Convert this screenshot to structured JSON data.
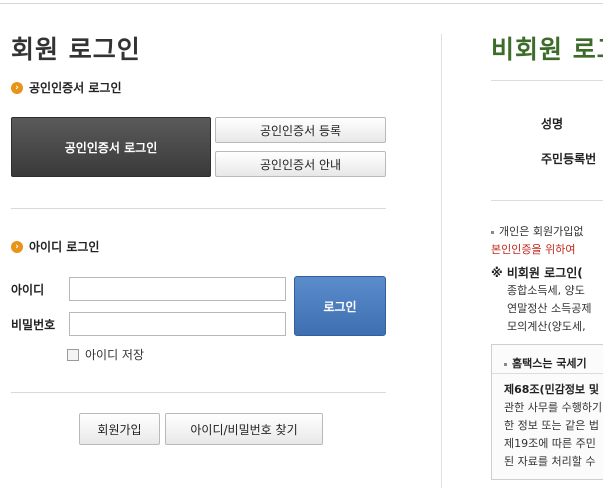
{
  "member": {
    "title": "회원 로그인",
    "cert_section": "공인인증서 로그인",
    "cert_login_button": "공인인증서 로그인",
    "cert_register_button": "공인인증서 등록",
    "cert_guide_button": "공인인증서 안내",
    "id_section": "아이디 로그인",
    "id_label": "아이디",
    "password_label": "비밀번호",
    "id_value": "",
    "password_value": "",
    "login_button": "로그인",
    "save_id_label": "아이디 저장",
    "signup_button": "회원가입",
    "find_button": "아이디/비밀번호 찾기"
  },
  "guest": {
    "title": "비회원 로그",
    "name_label": "성명",
    "rrn_label": "주민등록번",
    "info_line1": "개인은 회원가입없",
    "info_line2": "본인인증을 위하여",
    "heading": "※ 비회원 로그인(",
    "desc_line1": "종합소득세, 양도",
    "desc_line2": "연말정산 소득공제",
    "desc_line3": "모의계산(양도세,",
    "notice_head": "홈택스는 국세기",
    "notice_line1": "제68조(민감정보 및",
    "notice_line2": "관한 사무를 수행하기",
    "notice_line3": "한 정보 또는 같은 법",
    "notice_line4": "제19조에 따른 주민",
    "notice_line5": "된 자료를 처리할 수"
  },
  "colors": {
    "accent_orange": "#e89418",
    "login_blue": "#4a7cbf",
    "guest_title_green": "#3d6b2a",
    "warning_red": "#c0271c"
  }
}
